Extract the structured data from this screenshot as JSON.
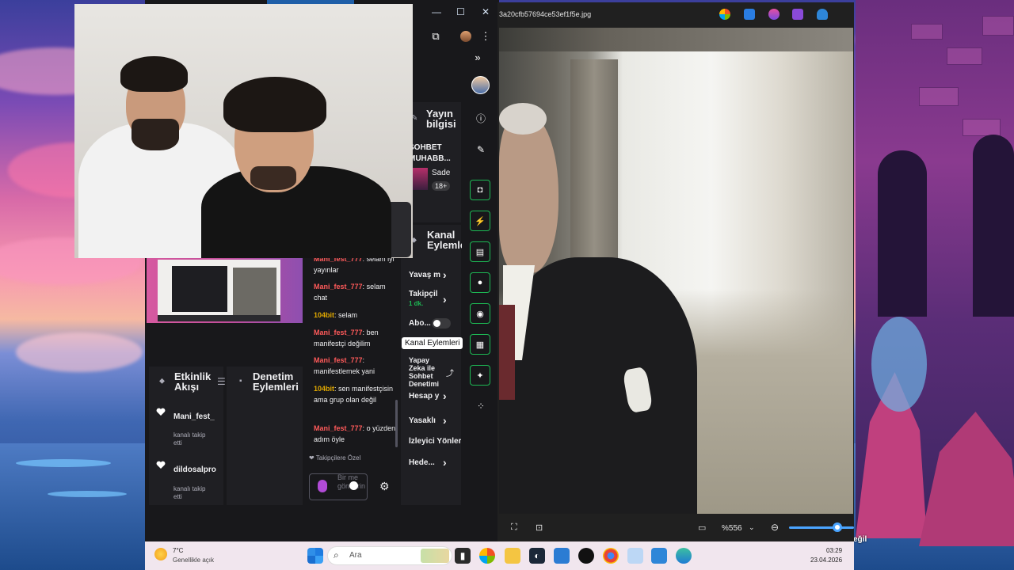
{
  "viewer": {
    "filename": "3a20cfb57694ce53ef1f5e.jpg",
    "zoom": "%556"
  },
  "stream_info": {
    "title": "Yayın bilgisi",
    "stream_title": "SOHBET MUHABB...",
    "category_short": "Sade",
    "rating_badge": "18+"
  },
  "channel_actions": {
    "title": "Kanal Eylemleri",
    "items": [
      {
        "label": "Yavaş m"
      },
      {
        "label": "Takipçil",
        "sub": "1 dk."
      },
      {
        "label": "Abo..."
      },
      {
        "label": "Yapay Zeka ile Sohbet Denetimi"
      },
      {
        "label": "Hesap y"
      },
      {
        "label": "Yasaklı"
      },
      {
        "label": "İzleyici Yönler"
      },
      {
        "label": "Hede..."
      }
    ],
    "tooltip": "Kanal Eylemleri",
    "accent_color": "#1db954"
  },
  "activity_feed": {
    "title": "Etkinlik Akışı",
    "items": [
      {
        "name": "Mani_fest_",
        "action": "kanalı takip etti"
      },
      {
        "name": "dildosalpro",
        "action": "kanalı takip etti"
      }
    ]
  },
  "moderation": {
    "title": "Denetim Eylemleri"
  },
  "chat": {
    "username_color": "#e8467c",
    "messages": [
      {
        "user": "Mani_fest_777",
        "text": "selam iyi yayınlar",
        "color": "#ff5a5a"
      },
      {
        "user": "Mani_fest_777",
        "text": "selam chat",
        "color": "#ff5a5a"
      },
      {
        "user": "104bit",
        "text": "selam",
        "color": "#e0a800"
      },
      {
        "user": "Mani_fest_777",
        "text": "ben manifestçi değilim",
        "color": "#ff5a5a"
      },
      {
        "user": "Mani_fest_777",
        "text": "manifestlemek yani",
        "color": "#ff5a5a"
      },
      {
        "user": "104bit",
        "text": "sen manifestçisin ama grup olan değil",
        "color": "#e0a800"
      },
      {
        "user": "Mani_fest_777",
        "text": "o yüzden adım öyle",
        "color": "#ff5a5a"
      }
    ],
    "followers_only": "Takipçilere Özel",
    "input_placeholder": "Bir me gönderin"
  },
  "taskbar": {
    "weather_temp": "7°C",
    "weather_desc": "Genellikle açık",
    "search_placeholder": "Ara",
    "time": "03:29",
    "date": "23.04.2026"
  },
  "desktop_text": "eğil"
}
